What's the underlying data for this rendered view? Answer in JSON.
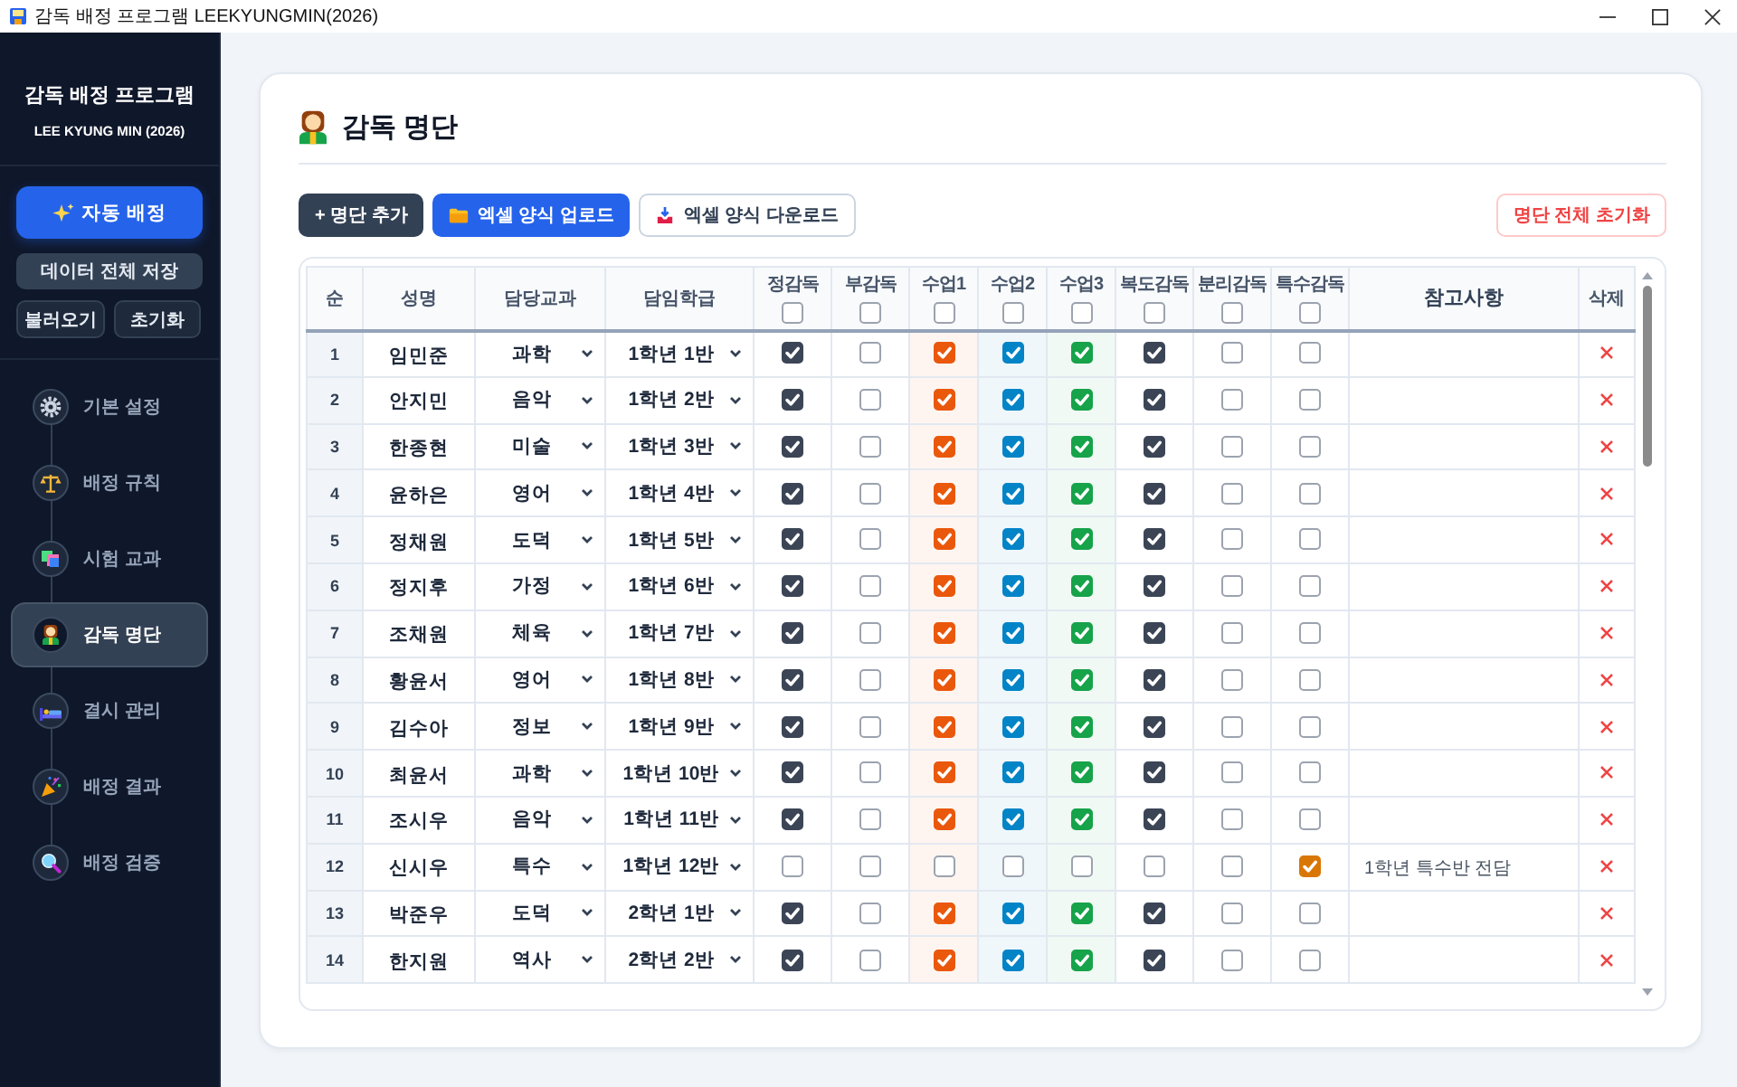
{
  "window": {
    "title": "감독 배정 프로그램 LEEKYUNGMIN(2026)"
  },
  "sidebar": {
    "title": "감독 배정 프로그램",
    "subtitle": "LEE KYUNG MIN (2026)",
    "actions": [
      {
        "label": "자동 배정",
        "kind": "primary"
      },
      {
        "label": "데이터 전체 저장",
        "kind": "wide"
      },
      {
        "label": "불러오기",
        "kind": "half"
      },
      {
        "label": "초기화",
        "kind": "half"
      }
    ],
    "nav": [
      {
        "label": "기본 설정",
        "kind": "settings",
        "selected": false
      },
      {
        "label": "배정 규칙",
        "kind": "rules",
        "selected": false
      },
      {
        "label": "시험 교과",
        "kind": "subjects",
        "selected": false
      },
      {
        "label": "감독 명단",
        "kind": "roster",
        "selected": true
      },
      {
        "label": "결시 관리",
        "kind": "absence",
        "selected": false
      },
      {
        "label": "배정 결과",
        "kind": "results",
        "selected": false
      },
      {
        "label": "배정 검증",
        "kind": "verify",
        "selected": false
      }
    ]
  },
  "page": {
    "title": "감독 명단",
    "toolbar": [
      {
        "label": "+ 명단 추가",
        "kind": "add"
      },
      {
        "label": "엑셀 양식 업로드",
        "kind": "upload"
      },
      {
        "label": "엑셀 양식 다운로드",
        "kind": "download"
      },
      {
        "label": "명단 전체 초기화",
        "kind": "reset"
      }
    ]
  },
  "table": {
    "columns": [
      {
        "label": "순",
        "kind": "index"
      },
      {
        "label": "성명",
        "kind": "name"
      },
      {
        "label": "담당교과",
        "kind": "subject"
      },
      {
        "label": "담임학급",
        "kind": "homeroom"
      },
      {
        "label": "정감독",
        "kind": "check",
        "checked": false,
        "color": "#3b4556"
      },
      {
        "label": "부감독",
        "kind": "check",
        "checked": false
      },
      {
        "label": "수업1",
        "kind": "lesson",
        "checked": false,
        "color": "#ea580c"
      },
      {
        "label": "수업2",
        "kind": "lesson",
        "checked": false,
        "color": "#0284c7"
      },
      {
        "label": "수업3",
        "kind": "lesson",
        "checked": false,
        "color": "#16a34a"
      },
      {
        "label": "복도감독",
        "kind": "check",
        "checked": false,
        "color": "#3b4556"
      },
      {
        "label": "분리감독",
        "kind": "check",
        "checked": false
      },
      {
        "label": "특수감독",
        "kind": "check",
        "checked": false,
        "color": "#d97706"
      },
      {
        "label": "참고사항",
        "kind": "note"
      },
      {
        "label": "삭제",
        "kind": "delete"
      }
    ],
    "rows": [
      {
        "no": "1",
        "name": "임민준",
        "subject": "과학",
        "homeroom": "1학년 1반",
        "checks": [
          true,
          false,
          true,
          true,
          true,
          true,
          false,
          false
        ]
      },
      {
        "no": "2",
        "name": "안지민",
        "subject": "음악",
        "homeroom": "1학년 2반",
        "checks": [
          true,
          false,
          true,
          true,
          true,
          true,
          false,
          false
        ]
      },
      {
        "no": "3",
        "name": "한종현",
        "subject": "미술",
        "homeroom": "1학년 3반",
        "checks": [
          true,
          false,
          true,
          true,
          true,
          true,
          false,
          false
        ]
      },
      {
        "no": "4",
        "name": "윤하은",
        "subject": "영어",
        "homeroom": "1학년 4반",
        "checks": [
          true,
          false,
          true,
          true,
          true,
          true,
          false,
          false
        ]
      },
      {
        "no": "5",
        "name": "정채원",
        "subject": "도덕",
        "homeroom": "1학년 5반",
        "checks": [
          true,
          false,
          true,
          true,
          true,
          true,
          false,
          false
        ]
      },
      {
        "no": "6",
        "name": "정지후",
        "subject": "가정",
        "homeroom": "1학년 6반",
        "checks": [
          true,
          false,
          true,
          true,
          true,
          true,
          false,
          false
        ]
      },
      {
        "no": "7",
        "name": "조채원",
        "subject": "체육",
        "homeroom": "1학년 7반",
        "checks": [
          true,
          false,
          true,
          true,
          true,
          true,
          false,
          false
        ]
      },
      {
        "no": "8",
        "name": "황윤서",
        "subject": "영어",
        "homeroom": "1학년 8반",
        "checks": [
          true,
          false,
          true,
          true,
          true,
          true,
          false,
          false
        ]
      },
      {
        "no": "9",
        "name": "김수아",
        "subject": "정보",
        "homeroom": "1학년 9반",
        "checks": [
          true,
          false,
          true,
          true,
          true,
          true,
          false,
          false
        ]
      },
      {
        "no": "10",
        "name": "최윤서",
        "subject": "과학",
        "homeroom": "1학년 10반",
        "checks": [
          true,
          false,
          true,
          true,
          true,
          true,
          false,
          false
        ]
      },
      {
        "no": "11",
        "name": "조시우",
        "subject": "음악",
        "homeroom": "1학년 11반",
        "checks": [
          true,
          false,
          true,
          true,
          true,
          true,
          false,
          false
        ]
      },
      {
        "no": "12",
        "name": "신시우",
        "subject": "특수",
        "homeroom": "1학년 12반",
        "checks": [
          false,
          false,
          false,
          false,
          false,
          false,
          false,
          true
        ],
        "note": "1학년 특수반 전담"
      },
      {
        "no": "13",
        "name": "박준우",
        "subject": "도덕",
        "homeroom": "2학년 1반",
        "checks": [
          true,
          false,
          true,
          true,
          true,
          true,
          false,
          false
        ]
      },
      {
        "no": "14",
        "name": "한지원",
        "subject": "역사",
        "homeroom": "2학년 2반",
        "checks": [
          true,
          false,
          true,
          true,
          true,
          true,
          false,
          false
        ]
      }
    ]
  }
}
